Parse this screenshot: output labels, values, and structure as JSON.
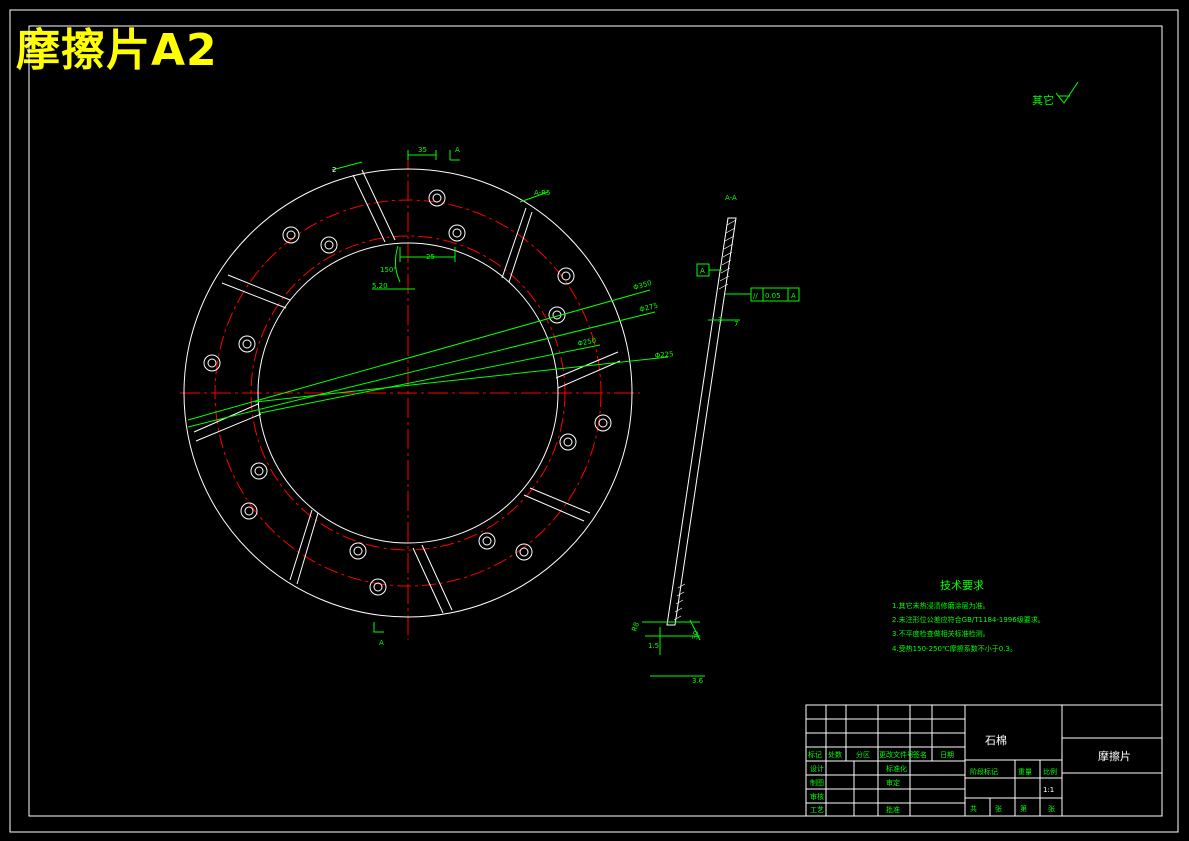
{
  "header": {
    "title": "摩擦片A2"
  },
  "roughness": {
    "label": "其它"
  },
  "dims": {
    "d35": "35",
    "a_top": "A",
    "two": "2",
    "a_r": "A-R5",
    "d25": "25",
    "ang": "150°",
    "d520": "5.20",
    "phi350": "Φ350",
    "phi275": "Φ275",
    "phi250": "Φ250",
    "phi225": "Φ225",
    "a_bottom": "A"
  },
  "section": {
    "title": "A-A",
    "datum": "A",
    "tol_sym": "//",
    "tol_val": "0.05",
    "tol_ref": "A",
    "d3": "3",
    "d7": "7",
    "d_r": "R8",
    "d15": "1.5",
    "d30": "30",
    "d36": "3.6"
  },
  "tech": {
    "title": "技术要求",
    "items": [
      "1.其它未热浸渍修磨涂层为准。",
      "2.未注形位公差应符合GB/T1184-1996级要求。",
      "3.不平度检查做相关标准检测。",
      "4.受热150-250℃摩擦系数不小于0.3。"
    ]
  },
  "title_block": {
    "material": "石棉",
    "part_name": "摩擦片",
    "hdr": [
      "标记",
      "处数",
      "分区",
      "更改文件号",
      "签名",
      "日期"
    ],
    "rows": [
      "设计",
      "制图",
      "审核",
      "工艺"
    ],
    "mid": [
      "标准化",
      "审定",
      "批准"
    ],
    "stage": "阶段标记",
    "weight": "重量",
    "scale": "比例",
    "scale_val": "1:1",
    "sheet": [
      "共",
      "张",
      "第",
      "张"
    ]
  }
}
